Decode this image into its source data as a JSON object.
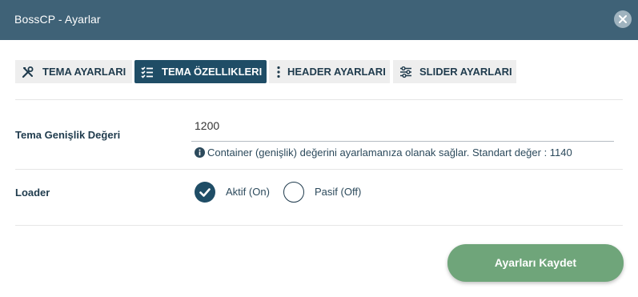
{
  "window": {
    "title": "BossCP - Ayarlar"
  },
  "tabs": [
    {
      "label": "TEMA AYARLARI",
      "icon": "tools-icon",
      "active": false
    },
    {
      "label": "TEMA ÖZELLIKLERI",
      "icon": "checklist-icon",
      "active": true
    },
    {
      "label": "HEADER AYARLARI",
      "icon": "vertical-dots-icon",
      "active": false
    },
    {
      "label": "SLIDER AYARLARI",
      "icon": "sliders-icon",
      "active": false
    }
  ],
  "theme_width": {
    "label": "Tema Genişlik Değeri",
    "value": "1200",
    "help": "Container (genişlik) değerini ayarlamanıza olanak sağlar. Standart değer : 1140"
  },
  "loader": {
    "label": "Loader",
    "options": [
      {
        "label": "Aktif (On)",
        "selected": true
      },
      {
        "label": "Pasif (Off)",
        "selected": false
      }
    ]
  },
  "save_button": {
    "label": "Ayarları Kaydet"
  },
  "colors": {
    "titlebar": "#3f6277",
    "active_tab": "#1f4d66",
    "save_button": "#6fa57a"
  }
}
